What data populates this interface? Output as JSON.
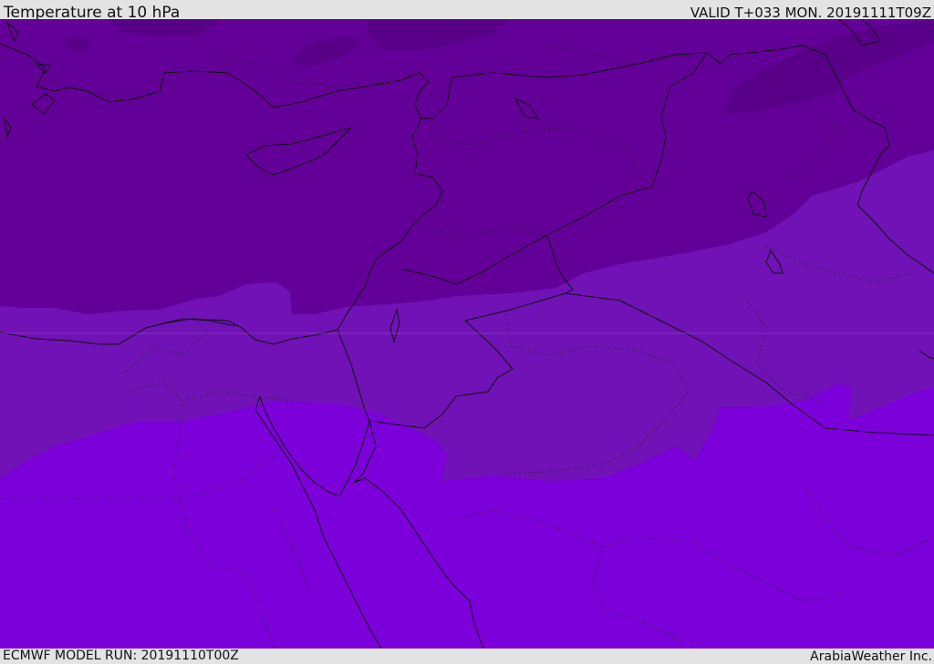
{
  "header": {
    "title": "Temperature at 10 hPa",
    "valid": "VALID T+033 MON. 20191111T09Z"
  },
  "footer": {
    "model_run": "ECMWF MODEL RUN: 20191110T00Z",
    "credit": "ArabiaWeather Inc."
  },
  "colors": {
    "band_darkest": "#580088",
    "band_dark": "#630098",
    "band_mid": "#7012b6",
    "band_light": "#7c00da",
    "border": "#111111",
    "background": "#e3e3e3"
  }
}
